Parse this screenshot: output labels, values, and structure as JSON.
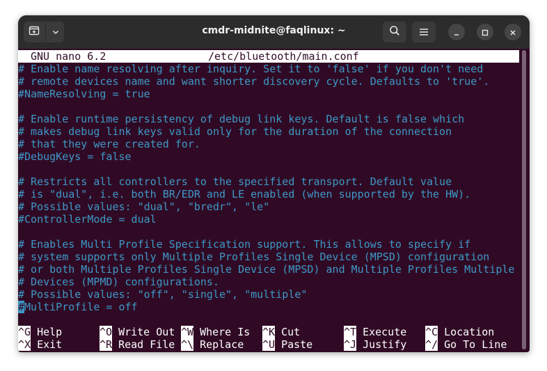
{
  "window": {
    "title": "cmdr-midnite@faqlinux: ~"
  },
  "titlebar_buttons": {
    "new_tab_icon": "new-tab-icon",
    "menu_dropdown_icon": "chevron-down-icon",
    "search_icon": "search-icon",
    "hamburger_icon": "hamburger-menu-icon",
    "minimize_icon": "minimize-icon",
    "maximize_icon": "maximize-icon",
    "close_icon": "close-icon"
  },
  "nano": {
    "version": "GNU nano 6.2",
    "filename": "/etc/bluetooth/main.conf",
    "lines": [
      "# Enable name resolving after inquiry. Set it to 'false' if you don't need",
      "# remote devices name and want shorter discovery cycle. Defaults to 'true'.",
      "#NameResolving = true",
      "",
      "# Enable runtime persistency of debug link keys. Default is false which",
      "# makes debug link keys valid only for the duration of the connection",
      "# that they were created for.",
      "#DebugKeys = false",
      "",
      "# Restricts all controllers to the specified transport. Default value",
      "# is \"dual\", i.e. both BR/EDR and LE enabled (when supported by the HW).",
      "# Possible values: \"dual\", \"bredr\", \"le\"",
      "#ControllerMode = dual",
      "",
      "# Enables Multi Profile Specification support. This allows to specify if",
      "# system supports only Multiple Profiles Single Device (MPSD) configuration",
      "# or both Multiple Profiles Single Device (MPSD) and Multiple Profiles Multiple",
      "# Devices (MPMD) configurations.",
      "# Possible values: \"off\", \"single\", \"multiple\""
    ],
    "cursor_line": {
      "cursor_char": "#",
      "rest": "MultiProfile = off"
    },
    "shortcuts_row1": [
      {
        "key": "^G",
        "label": "Help"
      },
      {
        "key": "^O",
        "label": "Write Out"
      },
      {
        "key": "^W",
        "label": "Where Is"
      },
      {
        "key": "^K",
        "label": "Cut"
      },
      {
        "key": "^T",
        "label": "Execute"
      },
      {
        "key": "^C",
        "label": "Location"
      }
    ],
    "shortcuts_row2": [
      {
        "key": "^X",
        "label": "Exit"
      },
      {
        "key": "^R",
        "label": "Read File"
      },
      {
        "key": "^\\",
        "label": "Replace"
      },
      {
        "key": "^U",
        "label": "Paste"
      },
      {
        "key": "^J",
        "label": "Justify"
      },
      {
        "key": "^/",
        "label": "Go To Line"
      }
    ]
  },
  "colors": {
    "terminal_bg": "#300a24",
    "comment": "#3d99c8",
    "header_bg": "#ffffff",
    "titlebar_bg": "#2c2c2c"
  }
}
